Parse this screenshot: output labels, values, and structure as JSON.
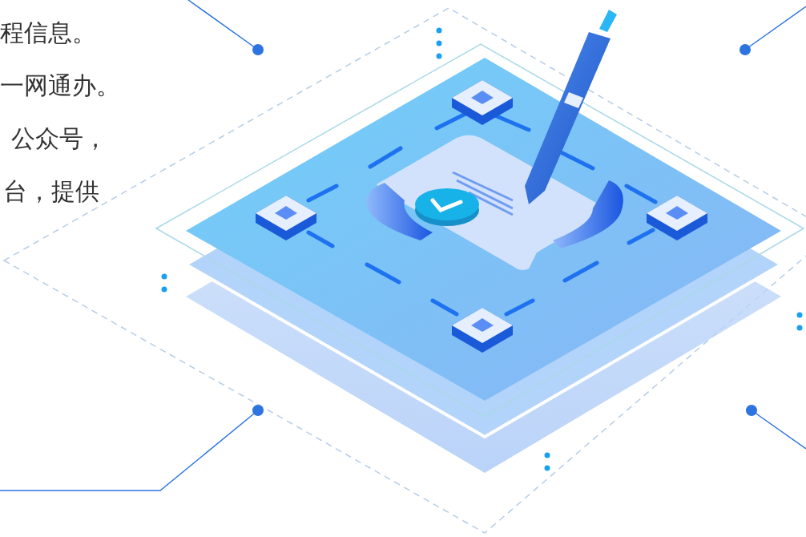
{
  "description_lines": [
    "程信息。",
    "一网通办。",
    "公众号，",
    "台，提供"
  ]
}
